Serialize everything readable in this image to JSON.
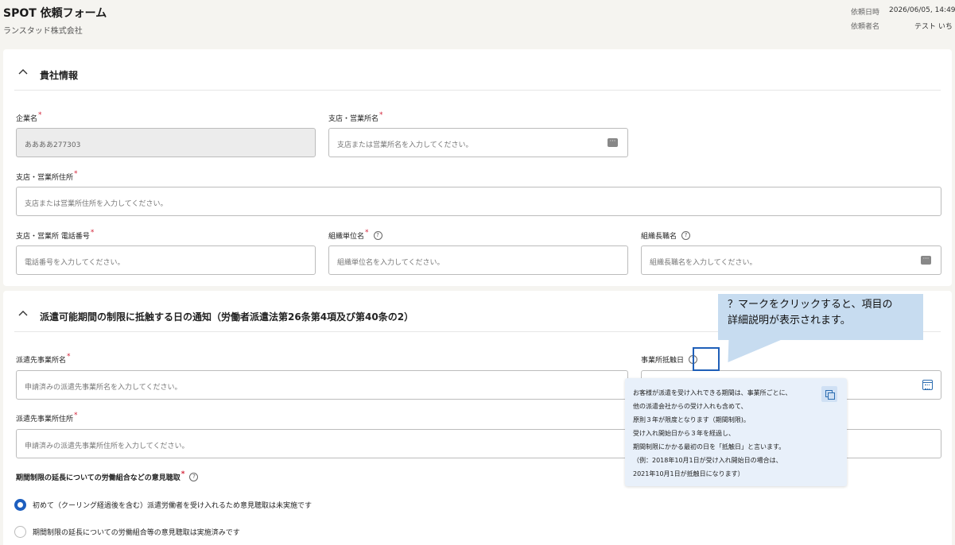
{
  "header": {
    "title": "SPOT 依頼フォーム",
    "company": "ランスタッド株式会社",
    "request_date_label": "依頼日時",
    "request_date_value": "2026/06/05, 14:49",
    "requester_label": "依頼者名",
    "requester_value": "テスト いち"
  },
  "section1": {
    "title": "貴社情報",
    "company_name_label": "企業名",
    "company_name_value": "ああああ277303",
    "branch_name_label": "支店・営業所名",
    "branch_name_placeholder": "支店または営業所名を入力してください。",
    "branch_address_label": "支店・営業所住所",
    "branch_address_placeholder": "支店または営業所住所を入力してください。",
    "phone_label": "支店・営業所 電話番号",
    "phone_placeholder": "電話番号を入力してください。",
    "org_unit_label": "組織単位名",
    "org_unit_placeholder": "組織単位名を入力してください。",
    "org_head_label": "組織長職名",
    "org_head_placeholder": "組織長職名を入力してください。"
  },
  "section2": {
    "title": "派遣可能期間の制限に抵触する日の通知（労働者派遣法第26条第4項及び第40条の2）",
    "dispatch_office_label": "派遣先事業所名",
    "dispatch_office_placeholder": "申請済みの派遣先事業所名を入力してください。",
    "conflict_date_label": "事業所抵触日",
    "dispatch_address_label": "派遣先事業所住所",
    "dispatch_address_placeholder": "申請済みの派遣先事業所住所を入力してください。",
    "hearing_label": "期間制限の延長についての労働組合などの意見聴取",
    "radio_options": [
      "初めて（クーリング経過後を含む）派遣労働者を受け入れるため意見聴取は未実施です",
      "期間制限の延長についての労働組合等の意見聴取は実施済みです"
    ],
    "selected_option": 0
  },
  "callout": {
    "line1": "？マークをクリックすると、項目の",
    "line2": "詳細説明が表示されます。"
  },
  "tooltip": {
    "lines": [
      "お客様が派遣を受け入れできる期間は、事業所ごとに、",
      "他の派遣会社からの受け入れも含めて、",
      "原則３年が限度となります（期間制限)。",
      "受け入れ開始日から３年を経過し、",
      "期間制限にかかる最初の日を「抵触日」と言います。",
      "（例：2018年10月1日が受け入れ開始日の場合は、",
      "2021年10月1日が抵触日になります）"
    ]
  },
  "icons": {
    "collapse": "chevron-up-icon",
    "help": "question-circle-icon",
    "more": "ellipsis-icon",
    "calendar": "calendar-icon",
    "copy": "copy-icon"
  },
  "colors": {
    "accent": "#1d5fbf",
    "required": "#d3253a",
    "callout_bg": "#c7dcf0",
    "tooltip_bg": "#e8f0fa"
  }
}
